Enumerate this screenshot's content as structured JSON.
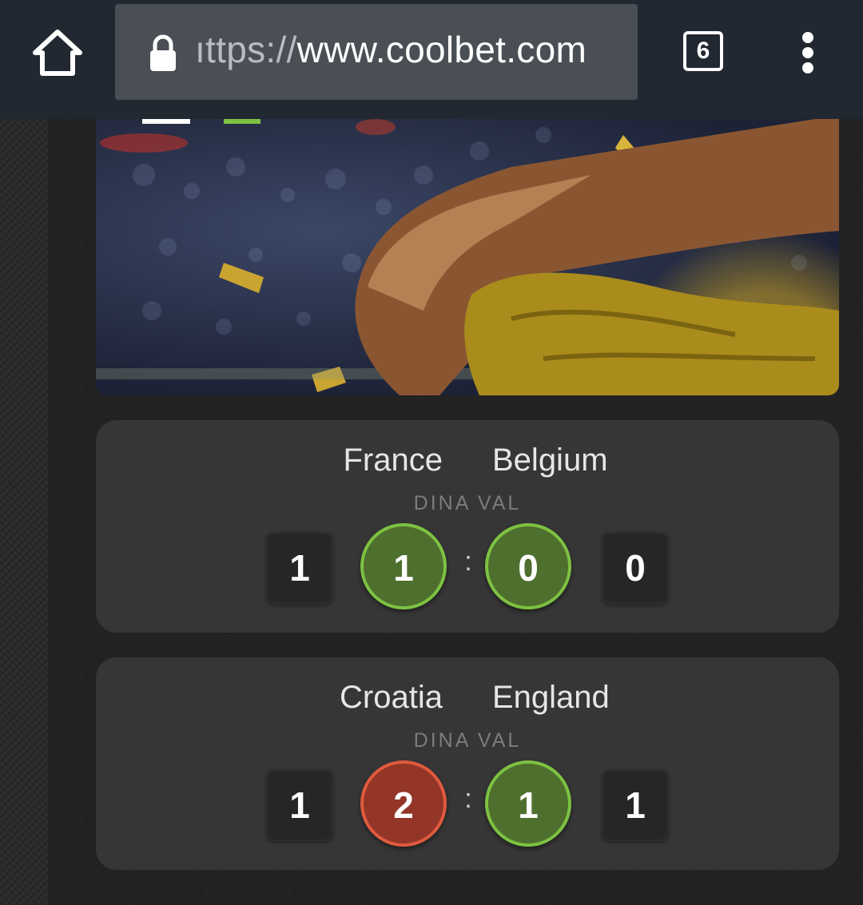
{
  "browser": {
    "url_scheme": "ıttps://",
    "url_host": "www.coolbet.com",
    "tab_count": "6",
    "icons": [
      "home-icon",
      "lock-icon",
      "tabs-icon",
      "overflow-menu-icon"
    ]
  },
  "matches": [
    {
      "home_team": "France",
      "away_team": "Belgium",
      "pick_label": "DINA VAL",
      "home_result": "1",
      "home_guess": "1",
      "separator": ":",
      "away_guess": "0",
      "away_result": "0",
      "home_guess_status": "correct",
      "away_guess_status": "correct"
    },
    {
      "home_team": "Croatia",
      "away_team": "England",
      "pick_label": "DINA VAL",
      "home_result": "1",
      "home_guess": "2",
      "separator": ":",
      "away_guess": "1",
      "away_result": "1",
      "home_guess_status": "wrong",
      "away_guess_status": "correct"
    }
  ],
  "colors": {
    "toolbar": "#222832",
    "url_box": "#4a4f55",
    "card": "#363636",
    "correct_fill": "#4e6f2e",
    "correct_ring": "#7dc242",
    "wrong_fill": "#933527",
    "wrong_ring": "#e05a3e"
  }
}
